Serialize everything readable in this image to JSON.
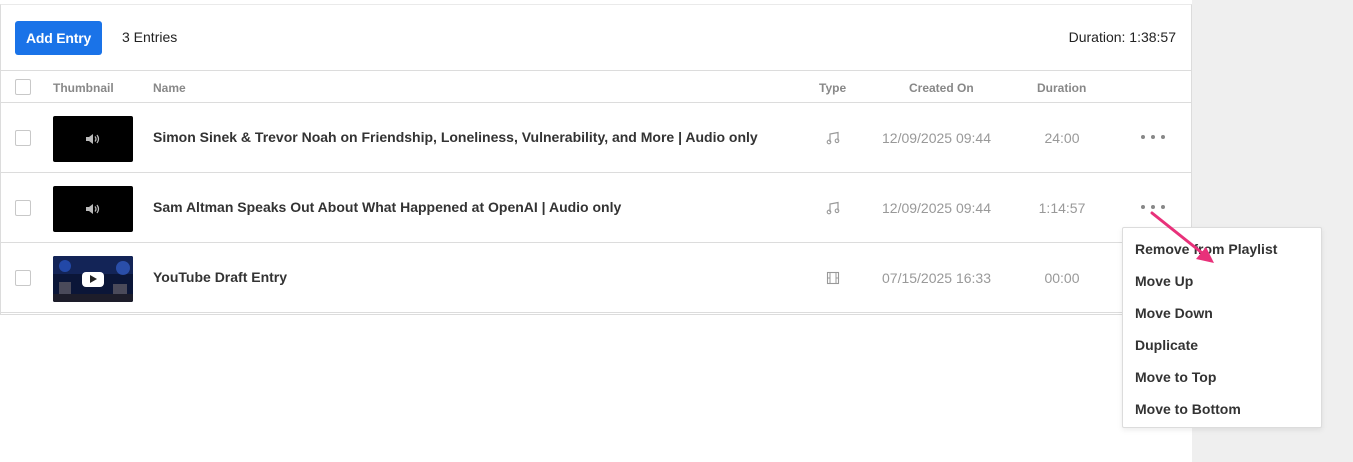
{
  "toolbar": {
    "add_label": "Add Entry",
    "entry_count": "3 Entries",
    "duration_total": "Duration: 1:38:57"
  },
  "table": {
    "headers": {
      "thumbnail": "Thumbnail",
      "name": "Name",
      "type": "Type",
      "created": "Created On",
      "duration": "Duration"
    },
    "rows": [
      {
        "name": "Simon Sinek & Trevor Noah on Friendship, Loneliness, Vulnerability, and More  |  Audio only",
        "type_icon": "audio-icon",
        "created": "12/09/2025 09:44",
        "duration": "24:00"
      },
      {
        "name": "Sam Altman Speaks Out About What Happened at OpenAI  |  Audio only",
        "type_icon": "audio-icon",
        "created": "12/09/2025 09:44",
        "duration": "1:14:57"
      },
      {
        "name": "YouTube Draft Entry",
        "type_icon": "video-icon",
        "created": "07/15/2025 16:33",
        "duration": "00:00"
      }
    ]
  },
  "menu": {
    "items": [
      "Remove from Playlist",
      "Move Up",
      "Move Down",
      "Duplicate",
      "Move to Top",
      "Move to Bottom"
    ]
  },
  "colors": {
    "accent": "#1a73e8",
    "annotation_arrow": "#e8317a"
  }
}
